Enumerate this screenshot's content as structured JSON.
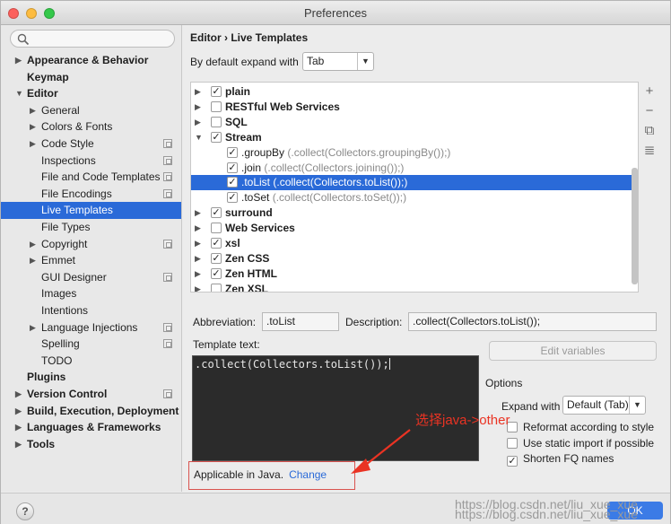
{
  "window": {
    "title": "Preferences"
  },
  "sidebar": {
    "search_placeholder": "",
    "items": [
      {
        "label": "Appearance & Behavior",
        "arrow": "▶",
        "bold": true,
        "level": 0,
        "selected": false,
        "icon": false
      },
      {
        "label": "Keymap",
        "arrow": "",
        "bold": true,
        "level": 0,
        "selected": false,
        "icon": false
      },
      {
        "label": "Editor",
        "arrow": "▼",
        "bold": true,
        "level": 0,
        "selected": false,
        "icon": false
      },
      {
        "label": "General",
        "arrow": "▶",
        "bold": false,
        "level": 1,
        "selected": false,
        "icon": false
      },
      {
        "label": "Colors & Fonts",
        "arrow": "▶",
        "bold": false,
        "level": 1,
        "selected": false,
        "icon": false
      },
      {
        "label": "Code Style",
        "arrow": "▶",
        "bold": false,
        "level": 1,
        "selected": false,
        "icon": true
      },
      {
        "label": "Inspections",
        "arrow": "",
        "bold": false,
        "level": 1,
        "selected": false,
        "icon": true
      },
      {
        "label": "File and Code Templates",
        "arrow": "",
        "bold": false,
        "level": 1,
        "selected": false,
        "icon": true
      },
      {
        "label": "File Encodings",
        "arrow": "",
        "bold": false,
        "level": 1,
        "selected": false,
        "icon": true
      },
      {
        "label": "Live Templates",
        "arrow": "",
        "bold": false,
        "level": 1,
        "selected": true,
        "icon": false
      },
      {
        "label": "File Types",
        "arrow": "",
        "bold": false,
        "level": 1,
        "selected": false,
        "icon": false
      },
      {
        "label": "Copyright",
        "arrow": "▶",
        "bold": false,
        "level": 1,
        "selected": false,
        "icon": true
      },
      {
        "label": "Emmet",
        "arrow": "▶",
        "bold": false,
        "level": 1,
        "selected": false,
        "icon": false
      },
      {
        "label": "GUI Designer",
        "arrow": "",
        "bold": false,
        "level": 1,
        "selected": false,
        "icon": true
      },
      {
        "label": "Images",
        "arrow": "",
        "bold": false,
        "level": 1,
        "selected": false,
        "icon": false
      },
      {
        "label": "Intentions",
        "arrow": "",
        "bold": false,
        "level": 1,
        "selected": false,
        "icon": false
      },
      {
        "label": "Language Injections",
        "arrow": "▶",
        "bold": false,
        "level": 1,
        "selected": false,
        "icon": true
      },
      {
        "label": "Spelling",
        "arrow": "",
        "bold": false,
        "level": 1,
        "selected": false,
        "icon": true
      },
      {
        "label": "TODO",
        "arrow": "",
        "bold": false,
        "level": 1,
        "selected": false,
        "icon": false
      },
      {
        "label": "Plugins",
        "arrow": "",
        "bold": true,
        "level": 0,
        "selected": false,
        "icon": false
      },
      {
        "label": "Version Control",
        "arrow": "▶",
        "bold": true,
        "level": 0,
        "selected": false,
        "icon": true
      },
      {
        "label": "Build, Execution, Deployment",
        "arrow": "▶",
        "bold": true,
        "level": 0,
        "selected": false,
        "icon": false
      },
      {
        "label": "Languages & Frameworks",
        "arrow": "▶",
        "bold": true,
        "level": 0,
        "selected": false,
        "icon": false
      },
      {
        "label": "Tools",
        "arrow": "▶",
        "bold": true,
        "level": 0,
        "selected": false,
        "icon": false
      }
    ]
  },
  "breadcrumb": "Editor › Live Templates",
  "expand_label": "By default expand with",
  "expand_value": "Tab",
  "templates": [
    {
      "arrow": "▶",
      "checked": true,
      "name": "plain",
      "desc": "",
      "bold": true,
      "child": false,
      "selected": false
    },
    {
      "arrow": "▶",
      "checked": false,
      "name": "RESTful Web Services",
      "desc": "",
      "bold": true,
      "child": false,
      "selected": false
    },
    {
      "arrow": "▶",
      "checked": false,
      "name": "SQL",
      "desc": "",
      "bold": true,
      "child": false,
      "selected": false
    },
    {
      "arrow": "▼",
      "checked": true,
      "name": "Stream",
      "desc": "",
      "bold": true,
      "child": false,
      "selected": false
    },
    {
      "arrow": "",
      "checked": true,
      "name": ".groupBy",
      "desc": "(.collect(Collectors.groupingBy());)",
      "bold": false,
      "child": true,
      "selected": false
    },
    {
      "arrow": "",
      "checked": true,
      "name": ".join",
      "desc": "(.collect(Collectors.joining());)",
      "bold": false,
      "child": true,
      "selected": false
    },
    {
      "arrow": "",
      "checked": true,
      "name": ".toList",
      "desc": "(.collect(Collectors.toList());)",
      "bold": false,
      "child": true,
      "selected": true
    },
    {
      "arrow": "",
      "checked": true,
      "name": ".toSet",
      "desc": "(.collect(Collectors.toSet());)",
      "bold": false,
      "child": true,
      "selected": false
    },
    {
      "arrow": "▶",
      "checked": true,
      "name": "surround",
      "desc": "",
      "bold": true,
      "child": false,
      "selected": false
    },
    {
      "arrow": "▶",
      "checked": false,
      "name": "Web Services",
      "desc": "",
      "bold": true,
      "child": false,
      "selected": false
    },
    {
      "arrow": "▶",
      "checked": true,
      "name": "xsl",
      "desc": "",
      "bold": true,
      "child": false,
      "selected": false
    },
    {
      "arrow": "▶",
      "checked": true,
      "name": "Zen CSS",
      "desc": "",
      "bold": true,
      "child": false,
      "selected": false
    },
    {
      "arrow": "▶",
      "checked": true,
      "name": "Zen HTML",
      "desc": "",
      "bold": true,
      "child": false,
      "selected": false
    },
    {
      "arrow": "▶",
      "checked": false,
      "name": "Zen XSL",
      "desc": "",
      "bold": true,
      "child": false,
      "selected": false
    }
  ],
  "tools": {
    "add": "+",
    "remove": "−",
    "copy": "⧉",
    "list": "≣"
  },
  "abbreviation_label": "Abbreviation:",
  "abbreviation_value": ".toList",
  "description_label": "Description:",
  "description_value": ".collect(Collectors.toList());",
  "template_text_label": "Template text:",
  "template_text": ".collect(Collectors.toList());",
  "edit_variables_label": "Edit variables",
  "options": {
    "title": "Options",
    "expand_with_label": "Expand with",
    "expand_with_value": "Default (Tab)",
    "checks": [
      {
        "label": "Reformat according to style",
        "checked": false
      },
      {
        "label": "Use static import if possible",
        "checked": false
      },
      {
        "label": "Shorten FQ names",
        "checked": true
      }
    ]
  },
  "applicable": {
    "text": "Applicable in Java.",
    "link": "Change"
  },
  "annotation": "选择java->other",
  "watermark": [
    "https://blog.csdn.net/liu_xue_xue",
    "https://blog.csdn.net/liu_xue_xue"
  ],
  "ok_label": "OK",
  "help_label": "?",
  "colors": {
    "selection": "#2a6ad8",
    "annotation": "#ea3323",
    "editor_bg": "#2b2b2b"
  }
}
